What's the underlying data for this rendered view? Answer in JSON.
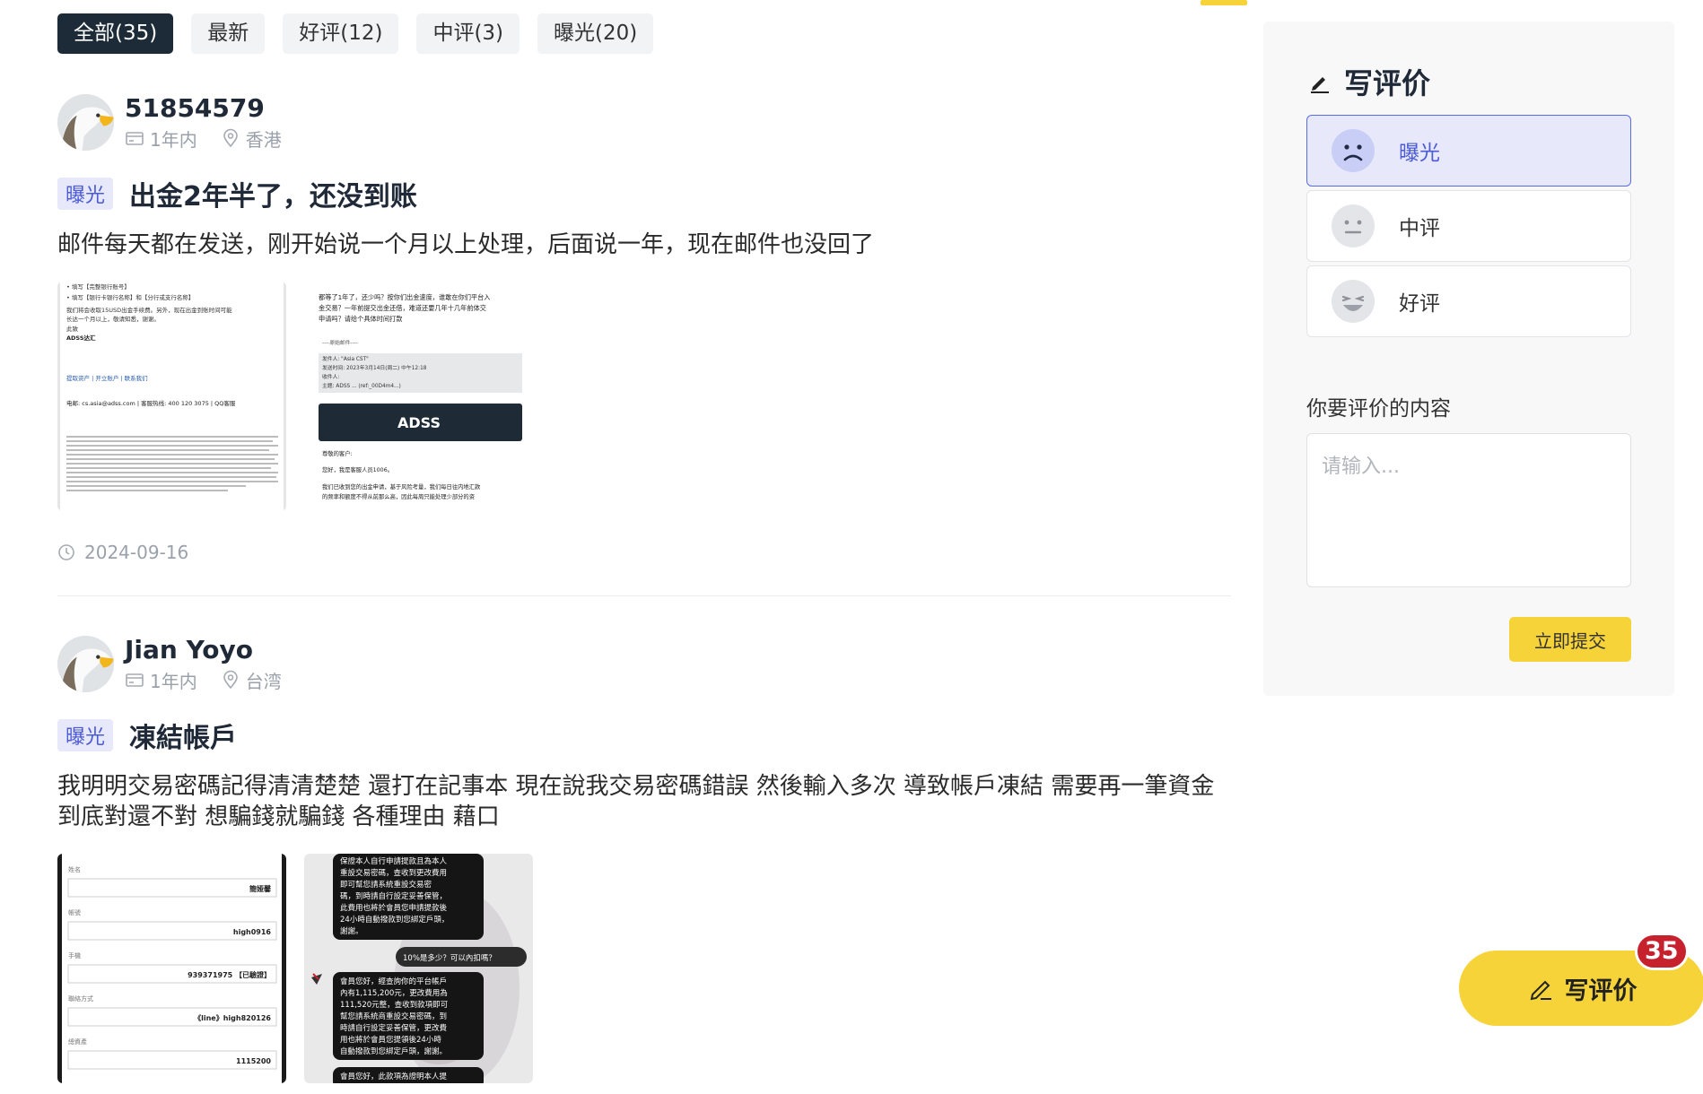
{
  "tabs": [
    {
      "label": "全部(35)",
      "active": true
    },
    {
      "label": "最新",
      "active": false
    },
    {
      "label": "好评(12)",
      "active": false
    },
    {
      "label": "中评(3)",
      "active": false
    },
    {
      "label": "曝光(20)",
      "active": false
    }
  ],
  "reviews": [
    {
      "username": "51854579",
      "period": "1年内",
      "location": "香港",
      "tag": "曝光",
      "title": "出金2年半了，还没到账",
      "body": "邮件每天都在发送，刚开始说一个月以上处理，后面说一年，现在邮件也没回了",
      "date": "2024-09-16",
      "images": {
        "email1_lines": [
          "• 填写【完整银行账号】",
          "• 填写【银行卡银行名称】和【分行或支行名称】",
          "我们将会收取15USD出金手续费。另外，现在出金到账时间可能",
          "长达一个月以上，敬请知悉，谢谢。",
          "此致",
          "ADSS达汇",
          "提取资产 | 开立账户 | 联系我们",
          "电邮: cs.asia@adss.com | 客服热线: 400 120 3075 | QQ客服"
        ],
        "email2_lines": [
          "都等了1年了，还少吗？按你们出金速度，谁敢在你们平台入",
          "金交易？一年前提交出金还借，难道还要几年十几年前体交",
          "申请吗？请给个具体时间打款",
          "----原始邮件----",
          "发件人: \"Asia CST\"",
          "发送时间: 2023年3月14日(周二) 中午12:18",
          "收件人:",
          "主题: ADSS ... (ref:_00D4m4...)",
          "ADSS",
          "尊敬的客户:",
          "您好，我是客服人员1006。",
          "我们已收到您的出金申请，基于风险考量，我们每日往内地汇款",
          "的频率和额度不得从前那么高，因此每周只能处理少部分的资"
        ]
      }
    },
    {
      "username": "Jian Yoyo",
      "period": "1年内",
      "location": "台湾",
      "tag": "曝光",
      "title": "凍結帳戶",
      "body": "我明明交易密碼記得清清楚楚 還打在記事本 現在說我交易密碼錯誤 然後輸入多次 導致帳戶凍結 需要再一筆資金到底對還不對 想騙錢就騙錢 各種理由 藉口",
      "images": {
        "form_labels": [
          "姓名",
          "帳號",
          "手機",
          "聯絡方式",
          "總資產"
        ],
        "form_values": [
          "簡娅馨",
          "high0916",
          "939371975 【已驗證】",
          "《line》high820126",
          "1115200"
        ],
        "chat_lines": [
          "保證本人自行申請提款且為本人",
          "重設交易密碼，查收到更改費用",
          "即可幫您請系統重設交易密",
          "碼，到時請自行設定妥善保管，",
          "此費用也將於會員您申請提款後",
          "24小時自動撥款到您綁定戶頭，",
          "謝謝。",
          "10%是多少？可以內扣嗎？",
          "會員您好，經查詢你的平台帳戶",
          "內有1,115,200元，更改費用為",
          "111,520元整，查收到款項即可",
          "幫您請系統商重設交易密碼，到",
          "時請自行設定妥善保管，更改費",
          "用也將於會員您提領後24小時",
          "自動撥款到您綁定戶頭，謝謝。",
          "會員您好，此款項為證明本人提"
        ]
      }
    }
  ],
  "sidebar": {
    "title": "写评价",
    "options": [
      {
        "label": "曝光",
        "selected": true
      },
      {
        "label": "中评",
        "selected": false
      },
      {
        "label": "好评",
        "selected": false
      }
    ],
    "content_label": "你要评价的内容",
    "content_placeholder": "请输入...",
    "submit_label": "立即提交"
  },
  "fab": {
    "label": "写评价",
    "badge": "35"
  },
  "colors": {
    "accent_yellow": "#f7d33a",
    "tab_active_bg": "#1d2a38",
    "tag_bg": "#e7e9fb",
    "tag_text": "#4c5bd4",
    "badge_red": "#c8212e"
  },
  "icons": [
    "card-icon",
    "location-pin-icon",
    "clock-icon",
    "edit-pencil-icon",
    "sad-face-icon",
    "neutral-face-icon",
    "happy-face-icon",
    "eagle-avatar"
  ]
}
